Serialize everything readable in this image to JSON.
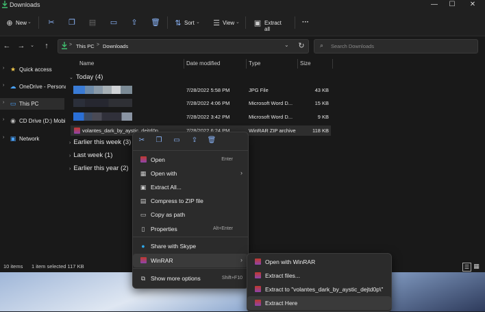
{
  "window": {
    "title": "Downloads"
  },
  "toolbar": {
    "new_label": "New",
    "sort_label": "Sort",
    "view_label": "View",
    "extract_all_label": "Extract all",
    "more_label": "···"
  },
  "address": {
    "crumb1": "This PC",
    "sep": ">",
    "crumb2": "Downloads"
  },
  "search": {
    "placeholder": "Search Downloads"
  },
  "sidebar": {
    "items": [
      {
        "label": "Quick access"
      },
      {
        "label": "OneDrive - Personal"
      },
      {
        "label": "This PC"
      },
      {
        "label": "CD Drive (D:) Mobile"
      },
      {
        "label": "Network"
      }
    ]
  },
  "columns": {
    "name": "Name",
    "date": "Date modified",
    "type": "Type",
    "size": "Size"
  },
  "groups": {
    "today": "Today (4)",
    "earlier_week": "Earlier this week (3)",
    "last_week": "Last week (1)",
    "earlier_year": "Earlier this year (2)"
  },
  "files": [
    {
      "name": "",
      "date": "7/28/2022 5:58 PM",
      "type": "JPG File",
      "size": "43 KB"
    },
    {
      "name": "",
      "date": "7/28/2022 4:06 PM",
      "type": "Microsoft Word D...",
      "size": "15 KB"
    },
    {
      "name": "",
      "date": "7/28/2022 3:42 PM",
      "type": "Microsoft Word D...",
      "size": "9 KB"
    },
    {
      "name": "volantes_dark_by_aystic_dejtd0p",
      "date": "7/28/2022 6:24 PM",
      "type": "WinRAR ZIP archive",
      "size": "118 KB"
    }
  ],
  "status": {
    "count": "10 items",
    "selected": "1 item selected  117 KB"
  },
  "context_menu": {
    "items": [
      {
        "label": "Open",
        "shortcut": "Enter"
      },
      {
        "label": "Open with",
        "shortcut": ""
      },
      {
        "label": "Extract All...",
        "shortcut": ""
      },
      {
        "label": "Compress to ZIP file",
        "shortcut": ""
      },
      {
        "label": "Copy as path",
        "shortcut": ""
      },
      {
        "label": "Properties",
        "shortcut": "Alt+Enter"
      },
      {
        "label": "Share with Skype",
        "shortcut": ""
      },
      {
        "label": "WinRAR",
        "shortcut": ""
      },
      {
        "label": "Show more options",
        "shortcut": "Shift+F10"
      }
    ]
  },
  "submenu": {
    "items": [
      {
        "label": "Open with WinRAR"
      },
      {
        "label": "Extract files..."
      },
      {
        "label": "Extract to \"volantes_dark_by_aystic_dejtd0p\\\""
      },
      {
        "label": "Extract Here"
      }
    ]
  },
  "colors": {
    "accent": "#8ab4f8",
    "background": "#191919",
    "menu": "#2b2b2b"
  }
}
